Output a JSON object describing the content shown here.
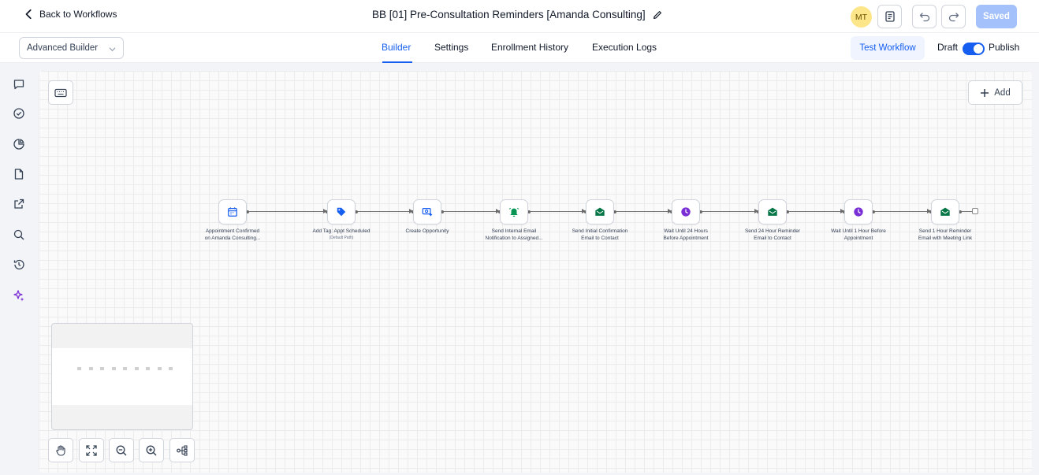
{
  "header": {
    "back_label": "Back to Workflows",
    "title": "BB [01] Pre-Consultation Reminders [Amanda Consulting]",
    "avatar_initials": "MT",
    "saved_label": "Saved"
  },
  "subheader": {
    "builder_mode": "Advanced Builder",
    "tabs": [
      {
        "label": "Builder",
        "active": true
      },
      {
        "label": "Settings",
        "active": false
      },
      {
        "label": "Enrollment History",
        "active": false
      },
      {
        "label": "Execution Logs",
        "active": false
      }
    ],
    "test_label": "Test Workflow",
    "draft_label": "Draft",
    "publish_label": "Publish",
    "published": true
  },
  "sidebar": {
    "icons": [
      "chat-icon",
      "check-circle-icon",
      "pie-chart-icon",
      "document-icon",
      "external-link-icon",
      "search-icon",
      "history-icon",
      "sparkle-icon"
    ]
  },
  "canvas": {
    "add_label": "Add",
    "nodes": [
      {
        "icon": "calendar-icon",
        "color": "#155eef",
        "label_1": "Appointment Confirmed",
        "label_2": "on Amanda Consulting...",
        "sub": ""
      },
      {
        "icon": "tag-icon",
        "color": "#155eef",
        "label_1": "Add Tag: Appt Scheduled",
        "label_2": "",
        "sub": "(Default Path)"
      },
      {
        "icon": "opportunity-icon",
        "color": "#155eef",
        "label_1": "Create Opportunity",
        "label_2": "",
        "sub": ""
      },
      {
        "icon": "bell-icon",
        "color": "#079455",
        "label_1": "Send Internal Email",
        "label_2": "Notification to Assigned...",
        "sub": ""
      },
      {
        "icon": "mail-icon",
        "color": "#067647",
        "label_1": "Send Initial Confirmation",
        "label_2": "Email to Contact",
        "sub": ""
      },
      {
        "icon": "clock-icon",
        "color": "#7a2ed6",
        "label_1": "Wait Until 24 Hours",
        "label_2": "Before Appointment",
        "sub": ""
      },
      {
        "icon": "mail-icon",
        "color": "#067647",
        "label_1": "Send 24 Hour Reminder",
        "label_2": "Email to Contact",
        "sub": ""
      },
      {
        "icon": "clock-icon",
        "color": "#7a2ed6",
        "label_1": "Wait Until 1 Hour Before",
        "label_2": "Appointment",
        "sub": ""
      },
      {
        "icon": "mail-icon",
        "color": "#067647",
        "label_1": "Send 1 Hour Reminder",
        "label_2": "Email with Meeting Link",
        "sub": ""
      }
    ]
  },
  "controls": [
    "hand-icon",
    "fit-view-icon",
    "zoom-out-icon",
    "zoom-in-icon",
    "auto-layout-icon"
  ],
  "colors": {
    "accent": "#155eef",
    "saved_bg": "#a4c1fb",
    "test_bg": "#eff4ff"
  }
}
